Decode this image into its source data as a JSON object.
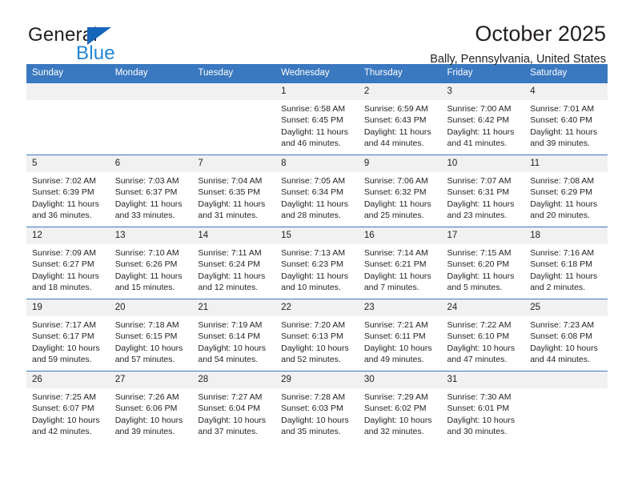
{
  "brand": {
    "name_part1": "General",
    "name_part2": "Blue",
    "triangle_icon": "blue-triangle-icon",
    "colors": {
      "dark": "#231f20",
      "blue": "#2286d4",
      "triangle": "#1565b8"
    }
  },
  "header": {
    "title": "October 2025",
    "subtitle": "Bally, Pennsylvania, United States"
  },
  "theme": {
    "header_row_bg": "#3a78bf",
    "daynum_bg": "#f1f1f1",
    "grid_line": "#3a78bf",
    "text": "#231f20"
  },
  "weekdays": [
    {
      "label": "Sunday"
    },
    {
      "label": "Monday"
    },
    {
      "label": "Tuesday"
    },
    {
      "label": "Wednesday"
    },
    {
      "label": "Thursday"
    },
    {
      "label": "Friday"
    },
    {
      "label": "Saturday"
    }
  ],
  "labels": {
    "sunrise_prefix": "Sunrise: ",
    "sunset_prefix": "Sunset: ",
    "daylight_prefix": "Daylight: "
  },
  "weeks": [
    [
      {
        "day": "",
        "empty": true
      },
      {
        "day": "",
        "empty": true
      },
      {
        "day": "",
        "empty": true
      },
      {
        "day": "1",
        "sunrise": "Sunrise: 6:58 AM",
        "sunset": "Sunset: 6:45 PM",
        "daylight": "Daylight: 11 hours and 46 minutes."
      },
      {
        "day": "2",
        "sunrise": "Sunrise: 6:59 AM",
        "sunset": "Sunset: 6:43 PM",
        "daylight": "Daylight: 11 hours and 44 minutes."
      },
      {
        "day": "3",
        "sunrise": "Sunrise: 7:00 AM",
        "sunset": "Sunset: 6:42 PM",
        "daylight": "Daylight: 11 hours and 41 minutes."
      },
      {
        "day": "4",
        "sunrise": "Sunrise: 7:01 AM",
        "sunset": "Sunset: 6:40 PM",
        "daylight": "Daylight: 11 hours and 39 minutes."
      }
    ],
    [
      {
        "day": "5",
        "sunrise": "Sunrise: 7:02 AM",
        "sunset": "Sunset: 6:39 PM",
        "daylight": "Daylight: 11 hours and 36 minutes."
      },
      {
        "day": "6",
        "sunrise": "Sunrise: 7:03 AM",
        "sunset": "Sunset: 6:37 PM",
        "daylight": "Daylight: 11 hours and 33 minutes."
      },
      {
        "day": "7",
        "sunrise": "Sunrise: 7:04 AM",
        "sunset": "Sunset: 6:35 PM",
        "daylight": "Daylight: 11 hours and 31 minutes."
      },
      {
        "day": "8",
        "sunrise": "Sunrise: 7:05 AM",
        "sunset": "Sunset: 6:34 PM",
        "daylight": "Daylight: 11 hours and 28 minutes."
      },
      {
        "day": "9",
        "sunrise": "Sunrise: 7:06 AM",
        "sunset": "Sunset: 6:32 PM",
        "daylight": "Daylight: 11 hours and 25 minutes."
      },
      {
        "day": "10",
        "sunrise": "Sunrise: 7:07 AM",
        "sunset": "Sunset: 6:31 PM",
        "daylight": "Daylight: 11 hours and 23 minutes."
      },
      {
        "day": "11",
        "sunrise": "Sunrise: 7:08 AM",
        "sunset": "Sunset: 6:29 PM",
        "daylight": "Daylight: 11 hours and 20 minutes."
      }
    ],
    [
      {
        "day": "12",
        "sunrise": "Sunrise: 7:09 AM",
        "sunset": "Sunset: 6:27 PM",
        "daylight": "Daylight: 11 hours and 18 minutes."
      },
      {
        "day": "13",
        "sunrise": "Sunrise: 7:10 AM",
        "sunset": "Sunset: 6:26 PM",
        "daylight": "Daylight: 11 hours and 15 minutes."
      },
      {
        "day": "14",
        "sunrise": "Sunrise: 7:11 AM",
        "sunset": "Sunset: 6:24 PM",
        "daylight": "Daylight: 11 hours and 12 minutes."
      },
      {
        "day": "15",
        "sunrise": "Sunrise: 7:13 AM",
        "sunset": "Sunset: 6:23 PM",
        "daylight": "Daylight: 11 hours and 10 minutes."
      },
      {
        "day": "16",
        "sunrise": "Sunrise: 7:14 AM",
        "sunset": "Sunset: 6:21 PM",
        "daylight": "Daylight: 11 hours and 7 minutes."
      },
      {
        "day": "17",
        "sunrise": "Sunrise: 7:15 AM",
        "sunset": "Sunset: 6:20 PM",
        "daylight": "Daylight: 11 hours and 5 minutes."
      },
      {
        "day": "18",
        "sunrise": "Sunrise: 7:16 AM",
        "sunset": "Sunset: 6:18 PM",
        "daylight": "Daylight: 11 hours and 2 minutes."
      }
    ],
    [
      {
        "day": "19",
        "sunrise": "Sunrise: 7:17 AM",
        "sunset": "Sunset: 6:17 PM",
        "daylight": "Daylight: 10 hours and 59 minutes."
      },
      {
        "day": "20",
        "sunrise": "Sunrise: 7:18 AM",
        "sunset": "Sunset: 6:15 PM",
        "daylight": "Daylight: 10 hours and 57 minutes."
      },
      {
        "day": "21",
        "sunrise": "Sunrise: 7:19 AM",
        "sunset": "Sunset: 6:14 PM",
        "daylight": "Daylight: 10 hours and 54 minutes."
      },
      {
        "day": "22",
        "sunrise": "Sunrise: 7:20 AM",
        "sunset": "Sunset: 6:13 PM",
        "daylight": "Daylight: 10 hours and 52 minutes."
      },
      {
        "day": "23",
        "sunrise": "Sunrise: 7:21 AM",
        "sunset": "Sunset: 6:11 PM",
        "daylight": "Daylight: 10 hours and 49 minutes."
      },
      {
        "day": "24",
        "sunrise": "Sunrise: 7:22 AM",
        "sunset": "Sunset: 6:10 PM",
        "daylight": "Daylight: 10 hours and 47 minutes."
      },
      {
        "day": "25",
        "sunrise": "Sunrise: 7:23 AM",
        "sunset": "Sunset: 6:08 PM",
        "daylight": "Daylight: 10 hours and 44 minutes."
      }
    ],
    [
      {
        "day": "26",
        "sunrise": "Sunrise: 7:25 AM",
        "sunset": "Sunset: 6:07 PM",
        "daylight": "Daylight: 10 hours and 42 minutes."
      },
      {
        "day": "27",
        "sunrise": "Sunrise: 7:26 AM",
        "sunset": "Sunset: 6:06 PM",
        "daylight": "Daylight: 10 hours and 39 minutes."
      },
      {
        "day": "28",
        "sunrise": "Sunrise: 7:27 AM",
        "sunset": "Sunset: 6:04 PM",
        "daylight": "Daylight: 10 hours and 37 minutes."
      },
      {
        "day": "29",
        "sunrise": "Sunrise: 7:28 AM",
        "sunset": "Sunset: 6:03 PM",
        "daylight": "Daylight: 10 hours and 35 minutes."
      },
      {
        "day": "30",
        "sunrise": "Sunrise: 7:29 AM",
        "sunset": "Sunset: 6:02 PM",
        "daylight": "Daylight: 10 hours and 32 minutes."
      },
      {
        "day": "31",
        "sunrise": "Sunrise: 7:30 AM",
        "sunset": "Sunset: 6:01 PM",
        "daylight": "Daylight: 10 hours and 30 minutes."
      },
      {
        "day": "",
        "empty": true
      }
    ]
  ]
}
